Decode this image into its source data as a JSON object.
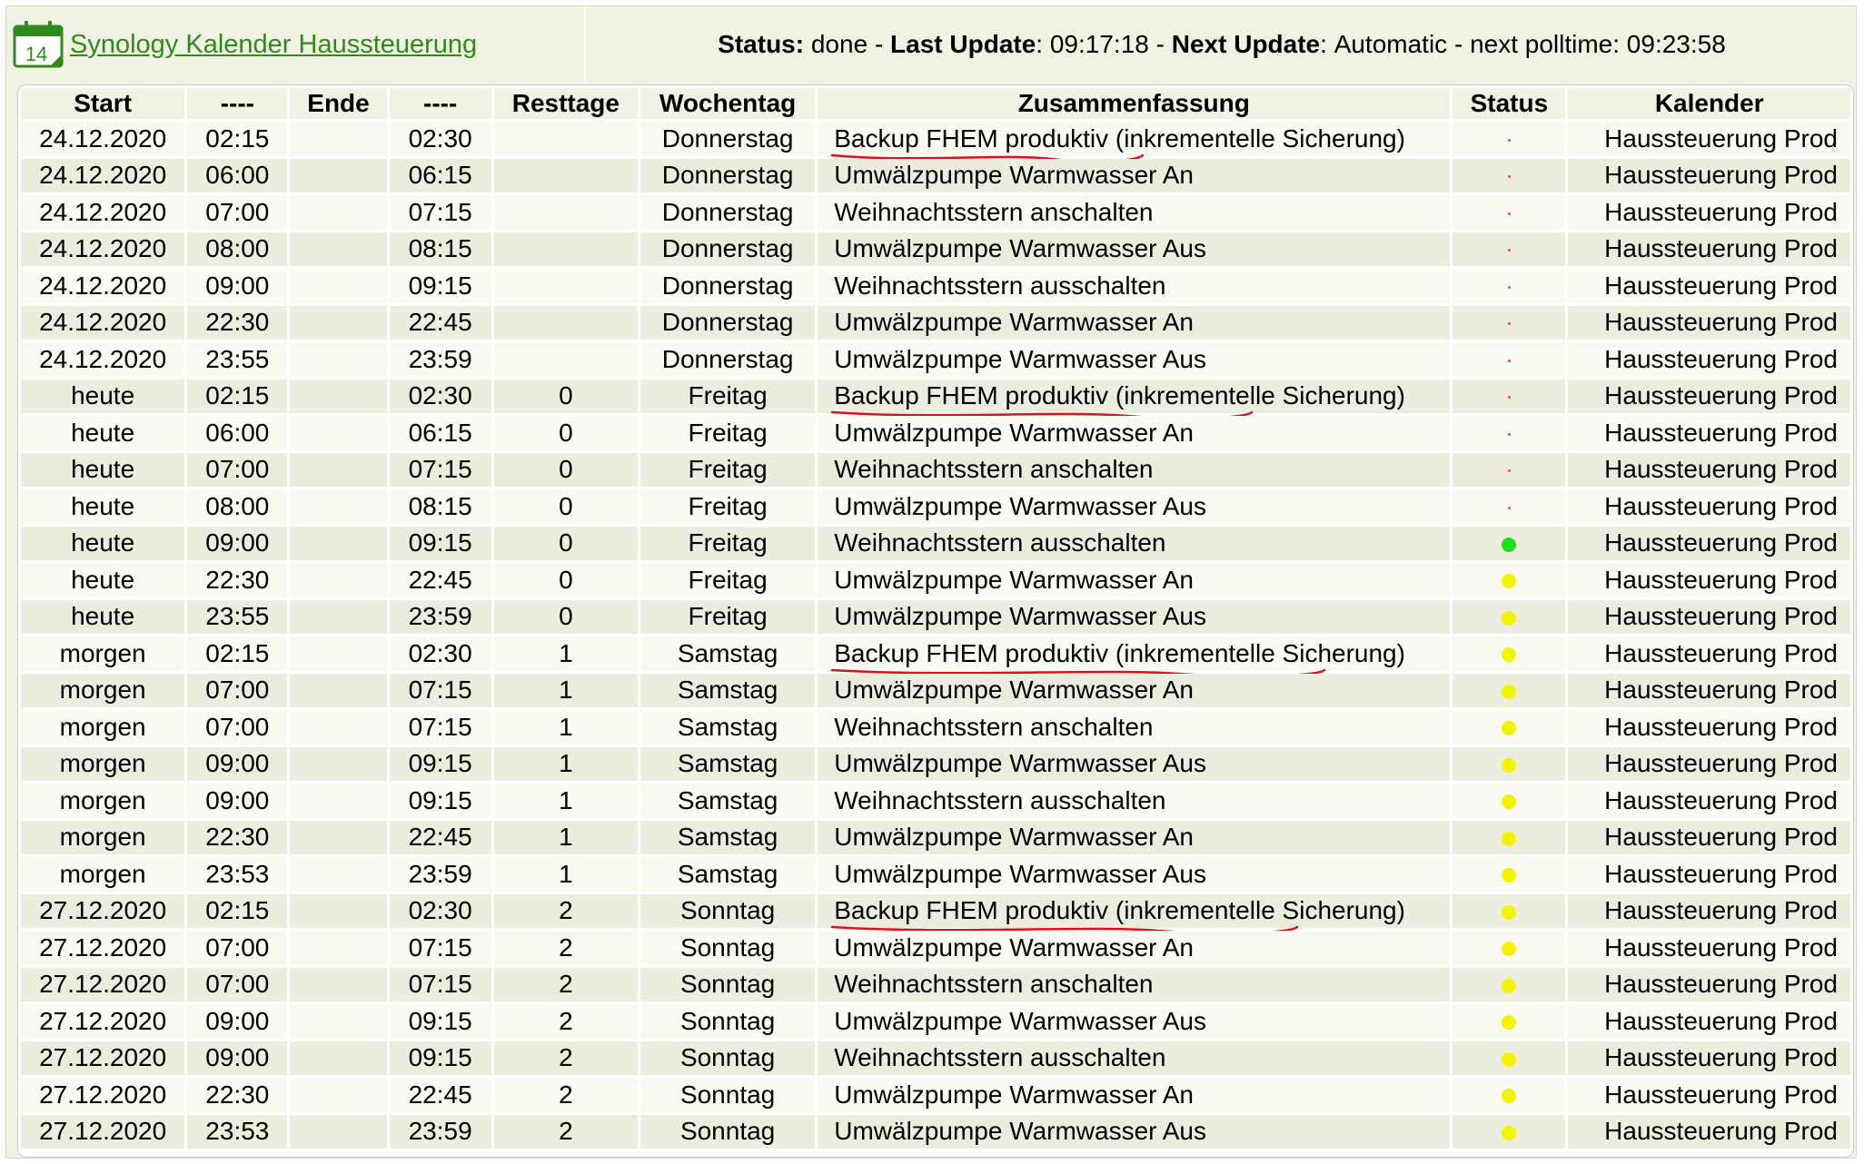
{
  "header": {
    "calendar_icon_number": "14",
    "calendar_link": "Synology Kalender Haussteuerung",
    "status_label": "Status:",
    "status_value": "done",
    "last_update_label": "Last Update",
    "last_update_value": "09:17:18",
    "next_update_label": "Next Update",
    "next_update_value": "Automatic - next polltime: 09:23:58",
    "separator": "-"
  },
  "table": {
    "columns": [
      "Start",
      "----",
      "Ende",
      "----",
      "Resttage",
      "Wochentag",
      "Zusammenfassung",
      "Status",
      "Kalender"
    ],
    "rows": [
      {
        "start": "24.12.2020",
        "start_time": "02:15",
        "end": "",
        "end_time": "02:30",
        "rest": "",
        "weekday": "Donnerstag",
        "summary": "Backup FHEM produktiv (inkrementelle Sicherung)",
        "status": "red",
        "calendar": "Haussteuerung Prod"
      },
      {
        "start": "24.12.2020",
        "start_time": "06:00",
        "end": "",
        "end_time": "06:15",
        "rest": "",
        "weekday": "Donnerstag",
        "summary": "Umwälzpumpe Warmwasser An",
        "status": "red",
        "calendar": "Haussteuerung Prod"
      },
      {
        "start": "24.12.2020",
        "start_time": "07:00",
        "end": "",
        "end_time": "07:15",
        "rest": "",
        "weekday": "Donnerstag",
        "summary": "Weihnachtsstern anschalten",
        "status": "red",
        "calendar": "Haussteuerung Prod"
      },
      {
        "start": "24.12.2020",
        "start_time": "08:00",
        "end": "",
        "end_time": "08:15",
        "rest": "",
        "weekday": "Donnerstag",
        "summary": "Umwälzpumpe Warmwasser Aus",
        "status": "red",
        "calendar": "Haussteuerung Prod"
      },
      {
        "start": "24.12.2020",
        "start_time": "09:00",
        "end": "",
        "end_time": "09:15",
        "rest": "",
        "weekday": "Donnerstag",
        "summary": "Weihnachtsstern ausschalten",
        "status": "red",
        "calendar": "Haussteuerung Prod"
      },
      {
        "start": "24.12.2020",
        "start_time": "22:30",
        "end": "",
        "end_time": "22:45",
        "rest": "",
        "weekday": "Donnerstag",
        "summary": "Umwälzpumpe Warmwasser An",
        "status": "red",
        "calendar": "Haussteuerung Prod"
      },
      {
        "start": "24.12.2020",
        "start_time": "23:55",
        "end": "",
        "end_time": "23:59",
        "rest": "",
        "weekday": "Donnerstag",
        "summary": "Umwälzpumpe Warmwasser Aus",
        "status": "red",
        "calendar": "Haussteuerung Prod"
      },
      {
        "start": "heute",
        "start_time": "02:15",
        "end": "",
        "end_time": "02:30",
        "rest": "0",
        "weekday": "Freitag",
        "summary": "Backup FHEM produktiv (inkrementelle Sicherung)",
        "status": "red",
        "calendar": "Haussteuerung Prod"
      },
      {
        "start": "heute",
        "start_time": "06:00",
        "end": "",
        "end_time": "06:15",
        "rest": "0",
        "weekday": "Freitag",
        "summary": "Umwälzpumpe Warmwasser An",
        "status": "red",
        "calendar": "Haussteuerung Prod"
      },
      {
        "start": "heute",
        "start_time": "07:00",
        "end": "",
        "end_time": "07:15",
        "rest": "0",
        "weekday": "Freitag",
        "summary": "Weihnachtsstern anschalten",
        "status": "red",
        "calendar": "Haussteuerung Prod"
      },
      {
        "start": "heute",
        "start_time": "08:00",
        "end": "",
        "end_time": "08:15",
        "rest": "0",
        "weekday": "Freitag",
        "summary": "Umwälzpumpe Warmwasser Aus",
        "status": "red",
        "calendar": "Haussteuerung Prod"
      },
      {
        "start": "heute",
        "start_time": "09:00",
        "end": "",
        "end_time": "09:15",
        "rest": "0",
        "weekday": "Freitag",
        "summary": "Weihnachtsstern ausschalten",
        "status": "green",
        "calendar": "Haussteuerung Prod"
      },
      {
        "start": "heute",
        "start_time": "22:30",
        "end": "",
        "end_time": "22:45",
        "rest": "0",
        "weekday": "Freitag",
        "summary": "Umwälzpumpe Warmwasser An",
        "status": "yellow",
        "calendar": "Haussteuerung Prod"
      },
      {
        "start": "heute",
        "start_time": "23:55",
        "end": "",
        "end_time": "23:59",
        "rest": "0",
        "weekday": "Freitag",
        "summary": "Umwälzpumpe Warmwasser Aus",
        "status": "yellow",
        "calendar": "Haussteuerung Prod"
      },
      {
        "start": "morgen",
        "start_time": "02:15",
        "end": "",
        "end_time": "02:30",
        "rest": "1",
        "weekday": "Samstag",
        "summary": "Backup FHEM produktiv (inkrementelle Sicherung)",
        "status": "yellow",
        "calendar": "Haussteuerung Prod"
      },
      {
        "start": "morgen",
        "start_time": "07:00",
        "end": "",
        "end_time": "07:15",
        "rest": "1",
        "weekday": "Samstag",
        "summary": "Umwälzpumpe Warmwasser An",
        "status": "yellow",
        "calendar": "Haussteuerung Prod"
      },
      {
        "start": "morgen",
        "start_time": "07:00",
        "end": "",
        "end_time": "07:15",
        "rest": "1",
        "weekday": "Samstag",
        "summary": "Weihnachtsstern anschalten",
        "status": "yellow",
        "calendar": "Haussteuerung Prod"
      },
      {
        "start": "morgen",
        "start_time": "09:00",
        "end": "",
        "end_time": "09:15",
        "rest": "1",
        "weekday": "Samstag",
        "summary": "Umwälzpumpe Warmwasser Aus",
        "status": "yellow",
        "calendar": "Haussteuerung Prod"
      },
      {
        "start": "morgen",
        "start_time": "09:00",
        "end": "",
        "end_time": "09:15",
        "rest": "1",
        "weekday": "Samstag",
        "summary": "Weihnachtsstern ausschalten",
        "status": "yellow",
        "calendar": "Haussteuerung Prod"
      },
      {
        "start": "morgen",
        "start_time": "22:30",
        "end": "",
        "end_time": "22:45",
        "rest": "1",
        "weekday": "Samstag",
        "summary": "Umwälzpumpe Warmwasser An",
        "status": "yellow",
        "calendar": "Haussteuerung Prod"
      },
      {
        "start": "morgen",
        "start_time": "23:53",
        "end": "",
        "end_time": "23:59",
        "rest": "1",
        "weekday": "Samstag",
        "summary": "Umwälzpumpe Warmwasser Aus",
        "status": "yellow",
        "calendar": "Haussteuerung Prod"
      },
      {
        "start": "27.12.2020",
        "start_time": "02:15",
        "end": "",
        "end_time": "02:30",
        "rest": "2",
        "weekday": "Sonntag",
        "summary": "Backup FHEM produktiv (inkrementelle Sicherung)",
        "status": "yellow",
        "calendar": "Haussteuerung Prod"
      },
      {
        "start": "27.12.2020",
        "start_time": "07:00",
        "end": "",
        "end_time": "07:15",
        "rest": "2",
        "weekday": "Sonntag",
        "summary": "Umwälzpumpe Warmwasser An",
        "status": "yellow",
        "calendar": "Haussteuerung Prod"
      },
      {
        "start": "27.12.2020",
        "start_time": "07:00",
        "end": "",
        "end_time": "07:15",
        "rest": "2",
        "weekday": "Sonntag",
        "summary": "Weihnachtsstern anschalten",
        "status": "yellow",
        "calendar": "Haussteuerung Prod"
      },
      {
        "start": "27.12.2020",
        "start_time": "09:00",
        "end": "",
        "end_time": "09:15",
        "rest": "2",
        "weekday": "Sonntag",
        "summary": "Umwälzpumpe Warmwasser Aus",
        "status": "yellow",
        "calendar": "Haussteuerung Prod"
      },
      {
        "start": "27.12.2020",
        "start_time": "09:00",
        "end": "",
        "end_time": "09:15",
        "rest": "2",
        "weekday": "Sonntag",
        "summary": "Weihnachtsstern ausschalten",
        "status": "yellow",
        "calendar": "Haussteuerung Prod"
      },
      {
        "start": "27.12.2020",
        "start_time": "22:30",
        "end": "",
        "end_time": "22:45",
        "rest": "2",
        "weekday": "Sonntag",
        "summary": "Umwälzpumpe Warmwasser An",
        "status": "yellow",
        "calendar": "Haussteuerung Prod"
      },
      {
        "start": "27.12.2020",
        "start_time": "23:53",
        "end": "",
        "end_time": "23:59",
        "rest": "2",
        "weekday": "Sonntag",
        "summary": "Umwälzpumpe Warmwasser Aus",
        "status": "yellow",
        "calendar": "Haussteuerung Prod"
      }
    ]
  },
  "annotations": {
    "underline_color": "#e0101a",
    "underlined_rows": [
      0,
      7,
      14,
      21
    ]
  },
  "colors": {
    "status_green": "#22dd22",
    "status_yellow": "#f4f400",
    "status_red": "#e84a3a",
    "link_green": "#2f8a1e"
  }
}
